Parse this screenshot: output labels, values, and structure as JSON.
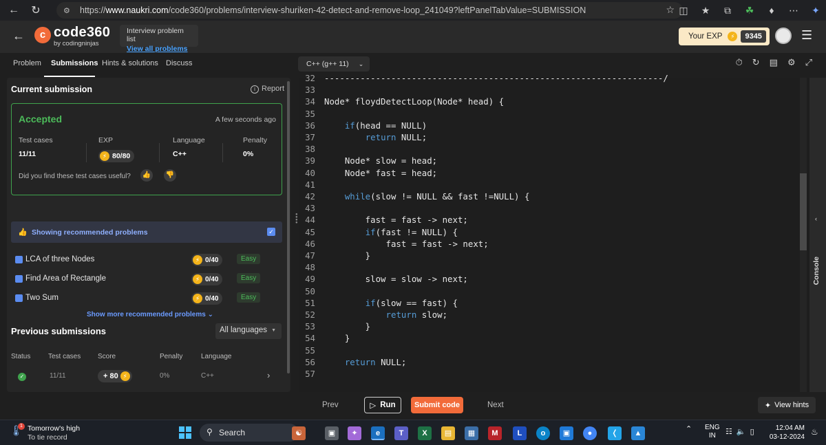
{
  "browser": {
    "url_scheme": "https://",
    "url_host": "www.naukri.com",
    "url_path": "/code360/problems/interview-shuriken-42-detect-and-remove-loop_241049?leftPanelTabValue=SUBMISSION"
  },
  "header": {
    "logo_text": "code360",
    "logo_sub": "by codingninjas",
    "problem_list_label": "Interview problem list",
    "view_all_label": "View all problems",
    "exp_label": "Your EXP",
    "exp_value": "9345"
  },
  "tabs": [
    "Problem",
    "Submissions",
    "Hints & solutions",
    "Discuss"
  ],
  "language_select": "C++ (g++ 11)",
  "current_submission": {
    "title": "Current submission",
    "report_label": "Report",
    "status": "Accepted",
    "time": "A few seconds ago",
    "stats": [
      {
        "label": "Test cases",
        "value": "11/11"
      },
      {
        "label": "EXP",
        "value": "80/80"
      },
      {
        "label": "Language",
        "value": "C++"
      },
      {
        "label": "Penalty",
        "value": "0%"
      }
    ],
    "useful_question": "Did you find these test cases useful?"
  },
  "recommended": {
    "banner": "Showing recommended problems",
    "problems": [
      {
        "name": "LCA of three Nodes",
        "score": "0/40",
        "difficulty": "Easy"
      },
      {
        "name": "Find Area of Rectangle",
        "score": "0/40",
        "difficulty": "Easy"
      },
      {
        "name": "Two Sum",
        "score": "0/40",
        "difficulty": "Easy"
      }
    ],
    "show_more": "Show more recommended problems"
  },
  "previous": {
    "title": "Previous submissions",
    "filter": "All languages",
    "headers": [
      "Status",
      "Test cases",
      "Score",
      "Penalty",
      "Language"
    ],
    "rows": [
      {
        "test_cases": "11/11",
        "score": "+ 80",
        "penalty": "0%",
        "language": "C++"
      }
    ]
  },
  "code": {
    "lines": [
      {
        "n": "32",
        "code": "------------------------------------------------------------------/"
      },
      {
        "n": "33",
        "code": ""
      },
      {
        "n": "34",
        "code": "Node* floydDetectLoop(Node* head) {"
      },
      {
        "n": "35",
        "code": ""
      },
      {
        "n": "36",
        "code": "    if(head == NULL)"
      },
      {
        "n": "37",
        "code": "        return NULL;"
      },
      {
        "n": "38",
        "code": ""
      },
      {
        "n": "39",
        "code": "    Node* slow = head;"
      },
      {
        "n": "40",
        "code": "    Node* fast = head;"
      },
      {
        "n": "41",
        "code": ""
      },
      {
        "n": "42",
        "code": "    while(slow != NULL && fast !=NULL) {"
      },
      {
        "n": "43",
        "code": ""
      },
      {
        "n": "44",
        "code": "        fast = fast -> next;"
      },
      {
        "n": "45",
        "code": "        if(fast != NULL) {"
      },
      {
        "n": "46",
        "code": "            fast = fast -> next;"
      },
      {
        "n": "47",
        "code": "        }"
      },
      {
        "n": "48",
        "code": ""
      },
      {
        "n": "49",
        "code": "        slow = slow -> next;"
      },
      {
        "n": "50",
        "code": ""
      },
      {
        "n": "51",
        "code": "        if(slow == fast) {"
      },
      {
        "n": "52",
        "code": "            return slow;"
      },
      {
        "n": "53",
        "code": "        }"
      },
      {
        "n": "54",
        "code": "    }"
      },
      {
        "n": "55",
        "code": ""
      },
      {
        "n": "56",
        "code": "    return NULL;"
      },
      {
        "n": "57",
        "code": ""
      }
    ]
  },
  "console_label": "Console",
  "actions": {
    "prev": "Prev",
    "run": "Run",
    "submit": "Submit code",
    "next": "Next",
    "hints": "View hints"
  },
  "taskbar": {
    "weather_title": "Tomorrow's high",
    "weather_sub": "To tie record",
    "weather_badge": "1",
    "search": "Search",
    "lang_line1": "ENG",
    "lang_line2": "IN",
    "time": "12:04 AM",
    "date": "03-12-2024"
  },
  "colors": {
    "accent": "#f26b3a",
    "accepted": "#4cbb5a",
    "keyword": "#569cd6",
    "link": "#4aa3ff"
  }
}
